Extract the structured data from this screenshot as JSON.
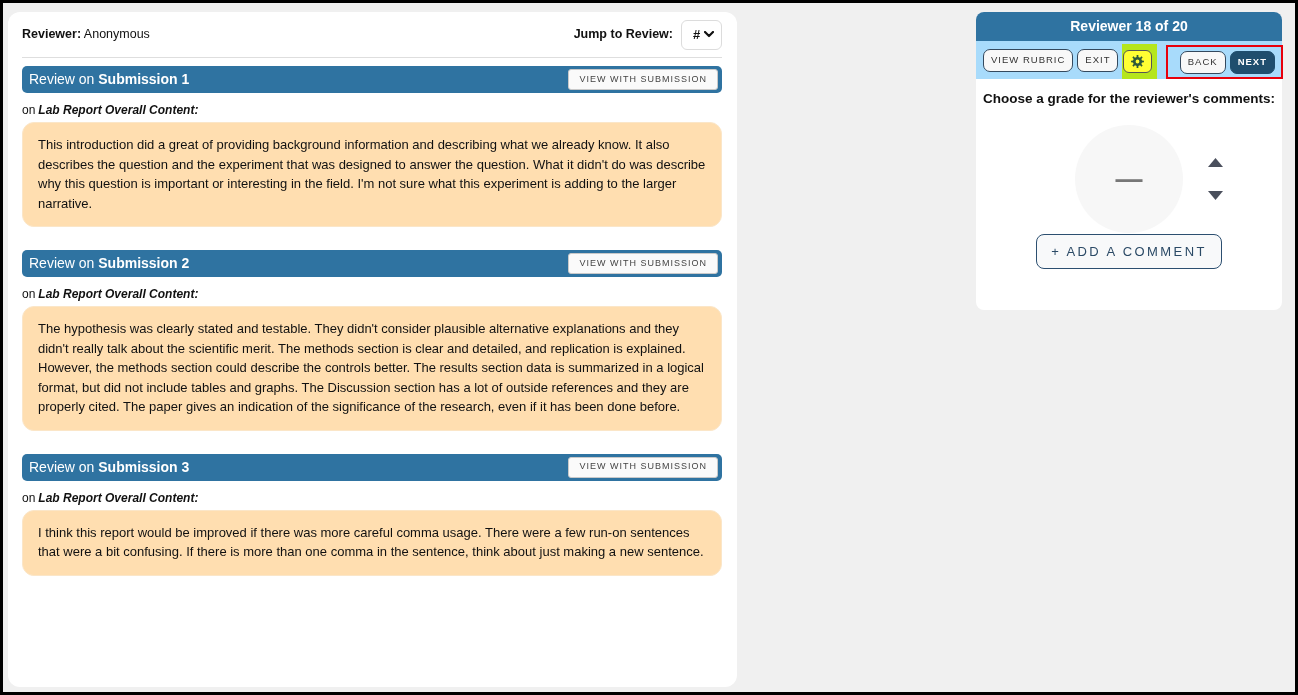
{
  "reviewer": "**Reviewer:** Anonymous",
  "jump_to_review": {
    "label": "Jump to Review:",
    "value": "#"
  },
  "reviews": [
    {
      "title": "Review on **Submission 1**",
      "button": "VIEW WITH SUBMISSION",
      "criterion_prefix": "on",
      "criterion": "Lab Report Overall Content:",
      "comment": "This introduction did a great of providing background information and describing what we already know. It also describes the question and the experiment that was designed to answer the question. What it didn't do was describe why this question is important or interesting in the field. I'm not sure what this experiment is adding to the larger narrative."
    },
    {
      "title": "Review on **Submission 2**",
      "button": "VIEW WITH SUBMISSION",
      "criterion_prefix": "on",
      "criterion": "Lab Report Overall Content:",
      "comment": "The hypothesis was clearly stated and testable. They didn't consider plausible alternative explanations and they didn't really talk about the scientific merit. The methods section is clear and detailed, and replication is explained. However, the methods section could describe the controls better. The results section data is summarized in a logical format, but did not include tables and graphs. The Discussion section has a lot of outside references and they are properly cited. The paper gives an indication of the significance of the research, even if it has been done before."
    },
    {
      "title": "Review on **Submission 3**",
      "button": "VIEW WITH SUBMISSION",
      "criterion_prefix": "on",
      "criterion": "Lab Report Overall Content:",
      "comment": "I think this report would be improved if there was more careful comma usage. There were a few run-on sentences that were a bit confusing. If there is more than one comma in the sentence, think about just making a new sentence."
    }
  ],
  "grading_panel": {
    "title": "Reviewer 18 of 20",
    "tool_buttons": [
      {
        "kind": "text",
        "label": "VIEW RUBRIC",
        "highlighted": false
      },
      {
        "kind": "text",
        "label": "EXIT",
        "highlighted": false
      },
      {
        "kind": "settings",
        "highlighted": true
      }
    ],
    "nav_framed": true,
    "nav_buttons": [
      {
        "kind": "outline",
        "label": "BACK"
      },
      {
        "kind": "filled",
        "label": "NEXT"
      }
    ],
    "prompt": "Choose a grade for the reviewer's comments:",
    "grade": "—",
    "add_comment_button": "+ ADD A COMMENT"
  }
}
